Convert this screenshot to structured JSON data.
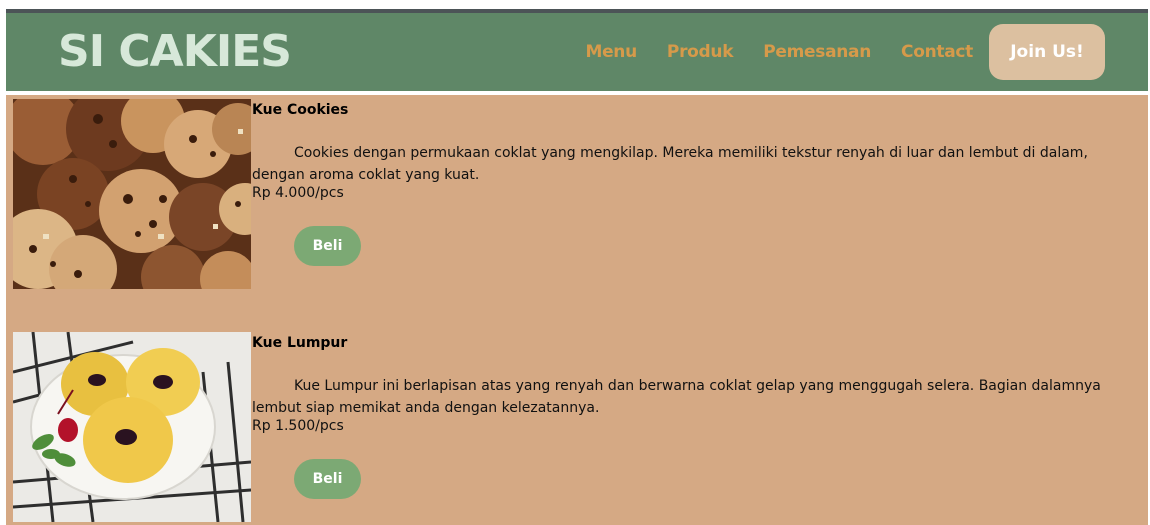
{
  "header": {
    "brand": "SI CAKIES",
    "nav": [
      "Menu",
      "Produk",
      "Pemesanan",
      "Contact"
    ],
    "join_label": "Join Us!"
  },
  "products": [
    {
      "title": "Kue Cookies",
      "description": "Cookies dengan permukaan coklat yang mengkilap. Mereka memiliki tekstur renyah di luar dan lembut di dalam, dengan aroma coklat yang kuat.",
      "price": "Rp 4.000/pcs",
      "buy_label": "Beli"
    },
    {
      "title": "Kue Lumpur",
      "description": "Kue Lumpur ini berlapisan atas yang renyah dan berwarna coklat gelap yang menggugah selera. Bagian dalamnya lembut siap memikat anda dengan kelezatannya.",
      "price": "Rp 1.500/pcs",
      "buy_label": "Beli"
    }
  ],
  "colors": {
    "header_bg": "#5f8767",
    "nav_text": "#d69a4a",
    "join_bg": "#dcc0a0",
    "content_bg": "#d5a984",
    "buy_button": "#7ca974"
  }
}
